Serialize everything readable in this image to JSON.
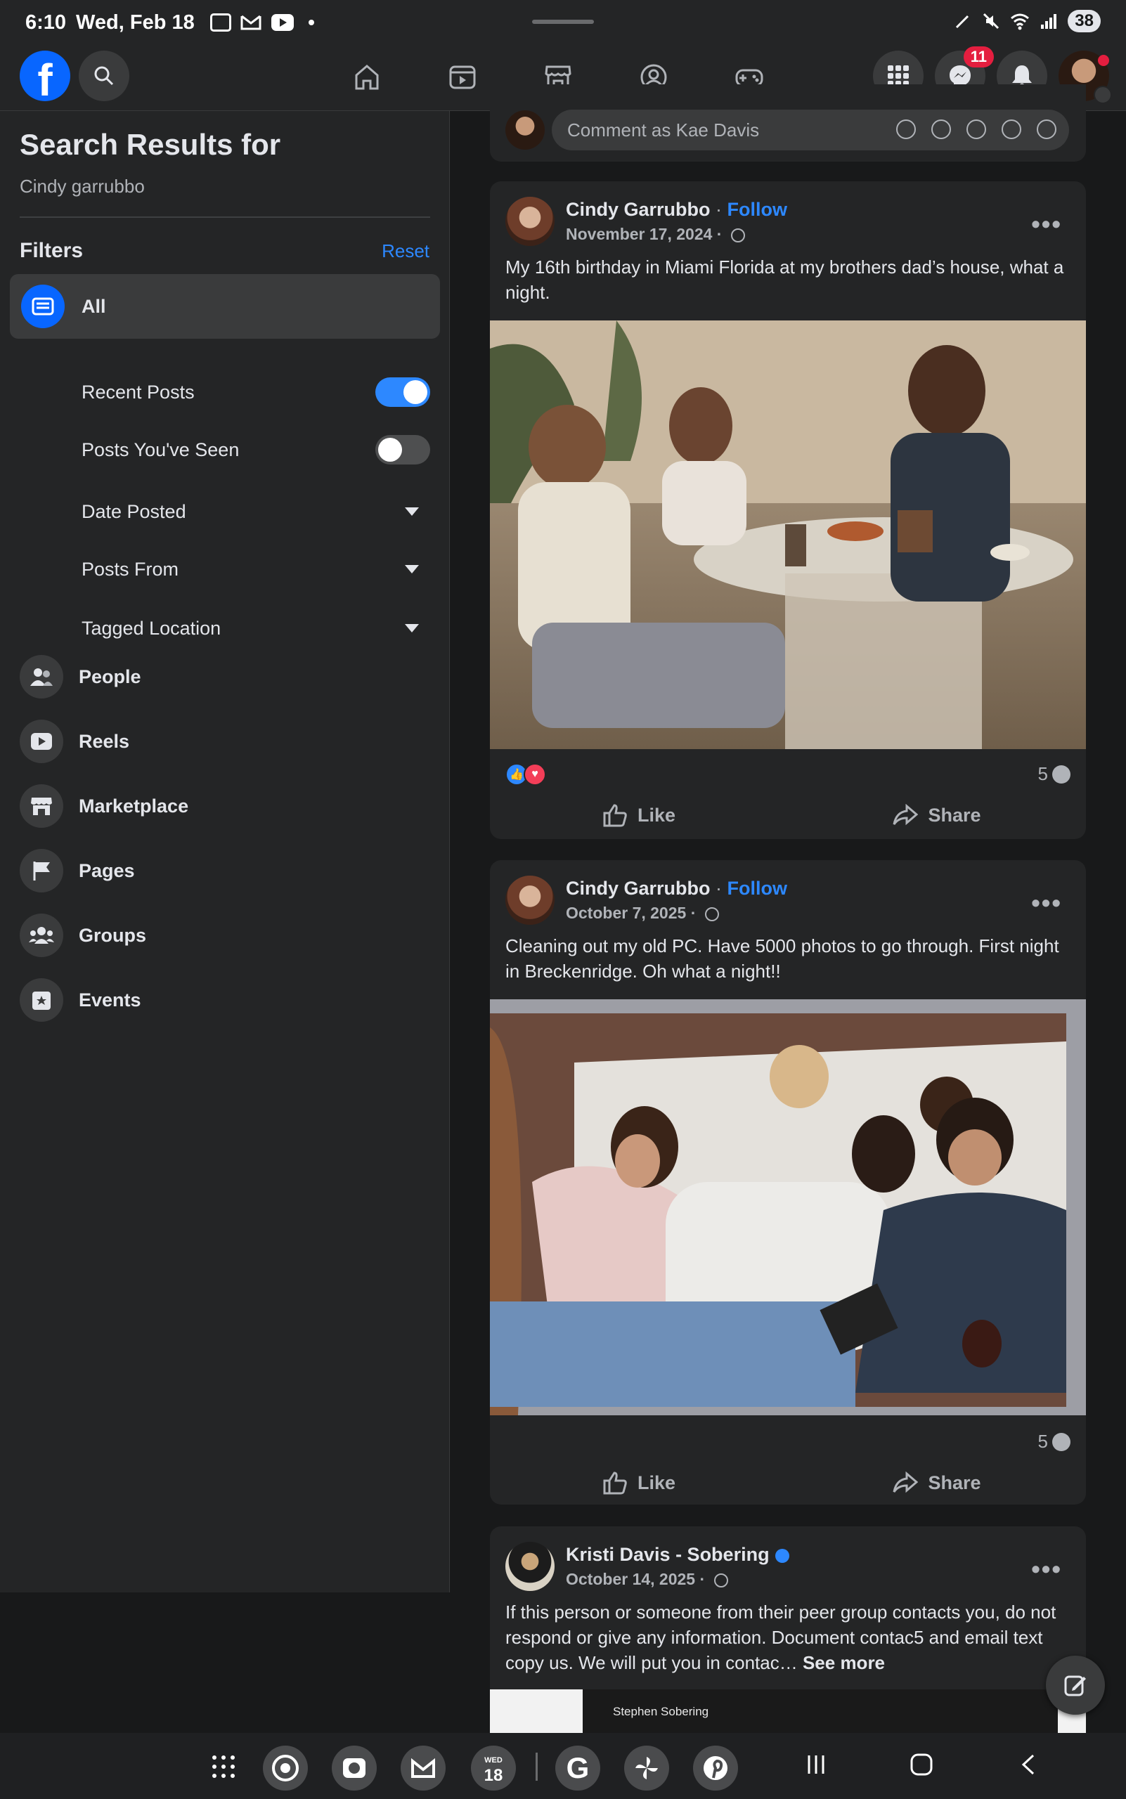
{
  "status_bar": {
    "time": "6:10",
    "date": "Wed, Feb 18",
    "battery": "38"
  },
  "nav": {
    "messenger_badge": "11"
  },
  "left": {
    "title": "Search Results for",
    "query": "Cindy garrubbo",
    "filters_label": "Filters",
    "reset_label": "Reset",
    "all_label": "All",
    "recent_posts": {
      "label": "Recent Posts",
      "on": true
    },
    "posts_seen": {
      "label": "Posts You've Seen",
      "on": false
    },
    "date_posted": "Date Posted",
    "posts_from": "Posts From",
    "tagged_location": "Tagged Location",
    "categories": [
      {
        "label": "People",
        "icon": "people-icon"
      },
      {
        "label": "Reels",
        "icon": "reels-icon"
      },
      {
        "label": "Marketplace",
        "icon": "marketplace-icon"
      },
      {
        "label": "Pages",
        "icon": "flag-icon"
      },
      {
        "label": "Groups",
        "icon": "groups-icon"
      },
      {
        "label": "Events",
        "icon": "events-icon"
      }
    ]
  },
  "comment_box": {
    "placeholder": "Comment as Kae Davis"
  },
  "posts": [
    {
      "author": "Cindy Garrubbo",
      "follow": "Follow",
      "date": "November 17, 2024",
      "text": "My 16th birthday in Miami Florida at my brothers dad’s house, what a night.",
      "comments": "5",
      "like": "Like",
      "share": "Share"
    },
    {
      "author": "Cindy Garrubbo",
      "follow": "Follow",
      "date": "October 7, 2025",
      "text": "Cleaning out my old PC. Have 5000 photos to go through. First night in Breckenridge. Oh what a night!!",
      "comments": "5",
      "like": "Like",
      "share": "Share"
    },
    {
      "author": "Kristi Davis - Sobering",
      "date": "October 14, 2025",
      "text": "If this person or someone from their peer group contacts you, do not respond or give any information. Document contac5 and email text copy us. We will put you in contac…",
      "see_more": "See more",
      "image_caption": "Stephen Sobering"
    }
  ],
  "dock": {
    "calendar_day": "18",
    "calendar_weekday": "WED"
  },
  "colors": {
    "accent": "#2d88ff",
    "fb_blue": "#0866ff",
    "badge_red": "#e41e3f",
    "background": "#18191a",
    "card": "#242526"
  }
}
